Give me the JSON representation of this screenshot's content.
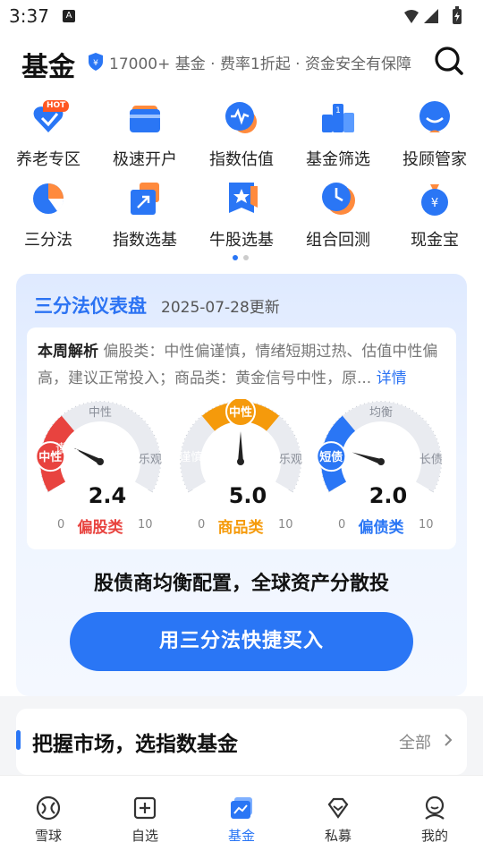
{
  "status_bar": {
    "time": "3:37",
    "badge": "A"
  },
  "header": {
    "title": "基金",
    "slogan": "17000+ 基金 · 费率1折起 · 资金安全有保障"
  },
  "shortcuts": [
    {
      "label": "养老专区",
      "icon": "heart-hot-icon",
      "badge": "HOT"
    },
    {
      "label": "极速开户",
      "icon": "card-icon"
    },
    {
      "label": "指数估值",
      "icon": "pulse-icon"
    },
    {
      "label": "基金筛选",
      "icon": "podium-icon"
    },
    {
      "label": "投顾管家",
      "icon": "smile-icon"
    },
    {
      "label": "三分法",
      "icon": "pie-icon"
    },
    {
      "label": "指数选基",
      "icon": "arrow-box-icon"
    },
    {
      "label": "牛股选基",
      "icon": "star-badge-icon"
    },
    {
      "label": "组合回测",
      "icon": "clock-icon"
    },
    {
      "label": "现金宝",
      "icon": "money-bag-icon"
    }
  ],
  "dashboard": {
    "title": "三分法仪表盘",
    "date": "2025-07-28更新",
    "analysis_label": "本周解析",
    "analysis_text": "偏股类：中性偏谨慎，情绪短期过热、估值中性偏高，建议正常投入；商品类：黄金信号中性，原...",
    "analysis_more": "详情",
    "gauges": [
      {
        "name": "偏股类",
        "value": 2.4,
        "badge": "中性",
        "left": "谨慎",
        "top": "中性",
        "right": "乐观",
        "min": "0",
        "max": "10",
        "color": "#e8433f"
      },
      {
        "name": "商品类",
        "value": 5.0,
        "badge": "中性",
        "left": "谨慎",
        "top": "中性",
        "right": "乐观",
        "min": "0",
        "max": "10",
        "color": "#f59a0b"
      },
      {
        "name": "偏债类",
        "value": 2.0,
        "badge": "短债",
        "left": "短债",
        "top": "均衡",
        "right": "长债",
        "min": "0",
        "max": "10",
        "color": "#2a76f5"
      }
    ],
    "slogan": "股债商均衡配置，全球资产分散投",
    "cta": "用三分法快捷买入"
  },
  "section": {
    "title": "把握市场，选指数基金",
    "all": "全部"
  },
  "tabs": [
    {
      "label": "雪球",
      "icon": "snowball-icon",
      "active": false
    },
    {
      "label": "自选",
      "icon": "plus-box-icon",
      "active": false
    },
    {
      "label": "基金",
      "icon": "fund-icon",
      "active": true
    },
    {
      "label": "私募",
      "icon": "diamond-icon",
      "active": false
    },
    {
      "label": "我的",
      "icon": "user-icon",
      "active": false
    }
  ],
  "colors": {
    "accent": "#2a76f5",
    "tab_active": "#2a76f5",
    "tab_inactive": "#333333"
  }
}
